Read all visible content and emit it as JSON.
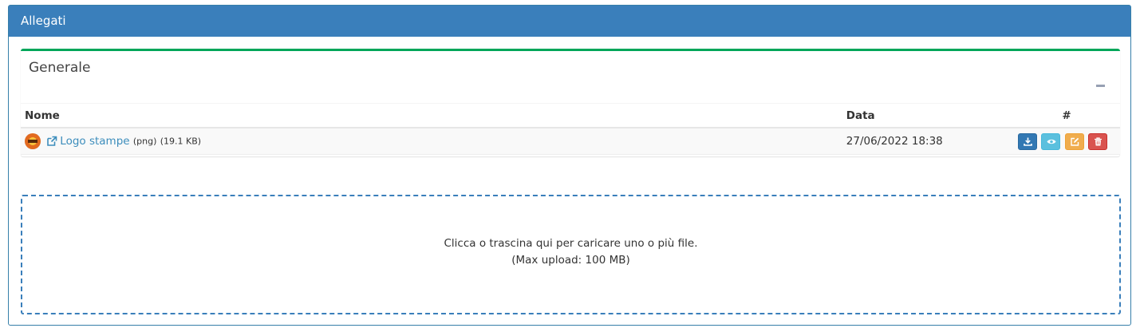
{
  "panel": {
    "title": "Allegati"
  },
  "box": {
    "title": "Generale"
  },
  "table": {
    "headers": {
      "name": "Nome",
      "date": "Data",
      "actions": "#"
    },
    "rows": [
      {
        "name": "Logo stampe",
        "type": "(png)",
        "size": "(19.1 KB)",
        "date": "27/06/2022 18:38"
      }
    ]
  },
  "dropzone": {
    "line1": "Clicca o trascina qui per caricare uno o più file.",
    "line2": "(Max upload: 100 MB)"
  },
  "colors": {
    "header_blue": "#3a7fbb",
    "box_green": "#00a65a",
    "link_blue": "#3c8dbc",
    "btn_download": "#3278b3",
    "btn_view": "#5bc0de",
    "btn_edit": "#f0ad4e",
    "btn_delete": "#d9534f"
  },
  "icons": {
    "thumbnail": "logo-thumbnail",
    "external_link": "external-link-icon",
    "download": "download-icon",
    "view": "eye-icon",
    "edit": "edit-icon",
    "delete": "trash-icon",
    "collapse": "minus-icon"
  }
}
